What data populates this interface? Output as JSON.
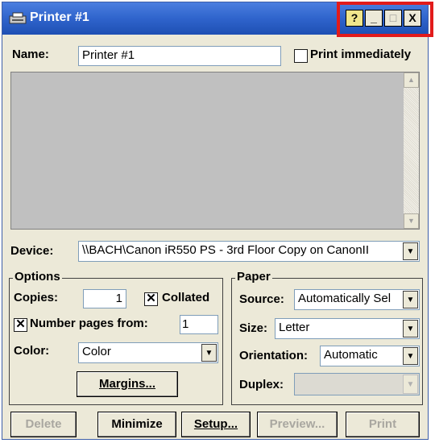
{
  "window": {
    "title": "Printer #1",
    "controls": {
      "help": "?",
      "minimize": "_",
      "maximize": "□",
      "close": "X"
    }
  },
  "name_row": {
    "label": "Name:",
    "value": "Printer #1",
    "print_immediately_label": "Print immediately",
    "print_immediately_checked": false
  },
  "device": {
    "label": "Device:",
    "value": "\\\\BACH\\Canon iR550 PS - 3rd Floor Copy on CanonII"
  },
  "options": {
    "title": "Options",
    "copies_label": "Copies:",
    "copies_value": "1",
    "collated_label": "Collated",
    "collated_checked": true,
    "number_pages_label": "Number pages from:",
    "number_pages_checked": true,
    "number_pages_value": "1",
    "color_label": "Color:",
    "color_value": "Color",
    "margins_label": "Margins..."
  },
  "paper": {
    "title": "Paper",
    "source_label": "Source:",
    "source_value": "Automatically Sel",
    "size_label": "Size:",
    "size_value": "Letter",
    "orientation_label": "Orientation:",
    "orientation_value": "Automatic",
    "duplex_label": "Duplex:",
    "duplex_value": ""
  },
  "buttons": {
    "delete": "Delete",
    "minimize": "Minimize",
    "setup": "Setup...",
    "preview": "Preview...",
    "print": "Print"
  },
  "colors": {
    "titlebar": "#2f64cc",
    "highlight": "#e21b1b",
    "face": "#ece9d8"
  }
}
